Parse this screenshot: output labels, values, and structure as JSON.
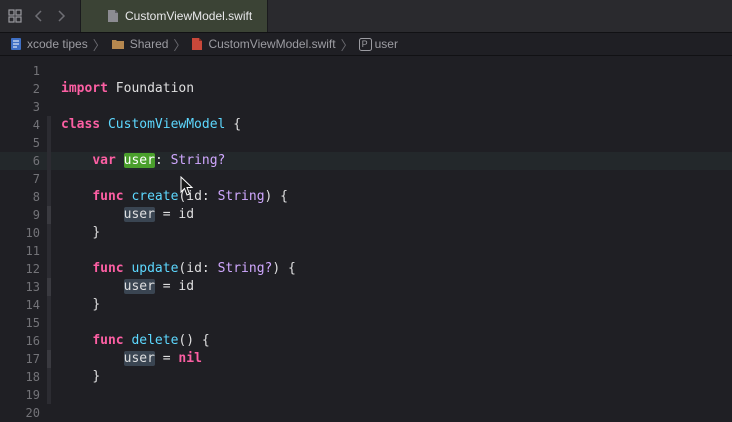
{
  "toolbar": {
    "tab_title": "CustomViewModel.swift",
    "grid_icon": "grid-icon",
    "back_icon": "chevron-left-icon",
    "forward_icon": "chevron-right-icon"
  },
  "breadcrumb": {
    "items": [
      {
        "label": "xcode tipes",
        "icon": "project-icon"
      },
      {
        "label": "Shared",
        "icon": "folder-icon"
      },
      {
        "label": "CustomViewModel.swift",
        "icon": "swift-file-icon"
      },
      {
        "label": "user",
        "icon": "property-icon",
        "badge": "P"
      }
    ]
  },
  "editor": {
    "current_line": 6,
    "line_numbers": [
      "1",
      "2",
      "3",
      "4",
      "5",
      "6",
      "7",
      "8",
      "9",
      "10",
      "11",
      "12",
      "13",
      "14",
      "15",
      "16",
      "17",
      "18",
      "19",
      "20"
    ],
    "tokens": {
      "import": "import",
      "foundation": "Foundation",
      "class": "class",
      "class_name": "CustomViewModel",
      "open_brace": " {",
      "var": "var",
      "user": "user",
      "colon_type": ": ",
      "string_opt": "String?",
      "func": "func",
      "create": "create",
      "update": "update",
      "delete": "delete",
      "id_param": "(id: ",
      "string": "String",
      "params_close": ") {",
      "delete_params": "() {",
      "assign_id": " = id",
      "assign_eq": " = ",
      "nil": "nil",
      "close_brace": "}"
    }
  },
  "colors": {
    "background": "#1f1f24",
    "keyword": "#fc5fa3",
    "type": "#d0a8ff",
    "declaration": "#5dd8ff",
    "highlight_active": "#4aa02c",
    "highlight": "#3a4552"
  }
}
